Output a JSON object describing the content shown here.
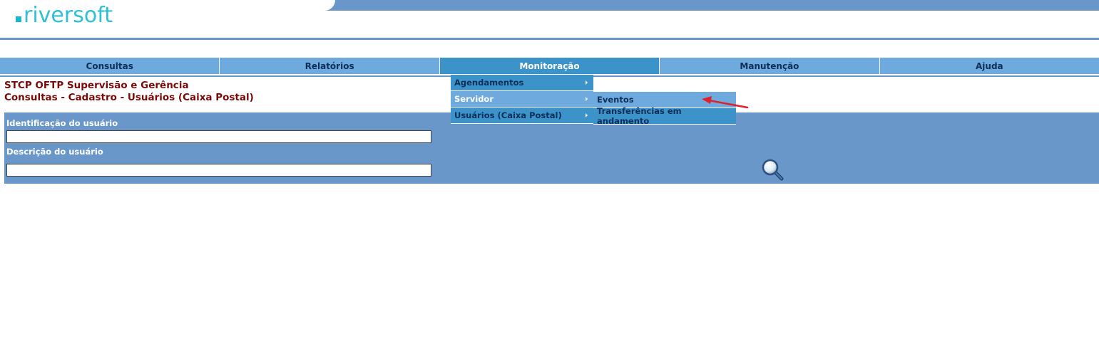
{
  "logo": {
    "text": "riversoft"
  },
  "nav": [
    {
      "label": "Consultas"
    },
    {
      "label": "Relatórios"
    },
    {
      "label": "Monitoração"
    },
    {
      "label": "Manutenção"
    },
    {
      "label": "Ajuda"
    }
  ],
  "page": {
    "title_line1": "STCP OFTP Supervisão e Gerência",
    "title_line2": "Consultas - Cadastro - Usuários (Caixa Postal)"
  },
  "form": {
    "user_id_label": "Identificação do usuário",
    "user_id_value": "",
    "user_desc_label": "Descrição do usuário",
    "user_desc_value": ""
  },
  "menu": {
    "items": [
      {
        "label": "Agendamentos"
      },
      {
        "label": "Servidor"
      },
      {
        "label": "Usuários (Caixa Postal)"
      }
    ]
  },
  "submenu": {
    "items": [
      {
        "label": "Eventos"
      },
      {
        "label": "Transferências em andamento"
      }
    ]
  },
  "icons": {
    "search": "magnifier-icon",
    "annotation": "red-arrow-icon"
  },
  "colors": {
    "panel": "#6a97c9",
    "nav": "#6eaade",
    "nav_active": "#3c93c9",
    "title": "#7a0a0a",
    "logo": "#2fc0d6",
    "annotation": "#e0202a"
  }
}
